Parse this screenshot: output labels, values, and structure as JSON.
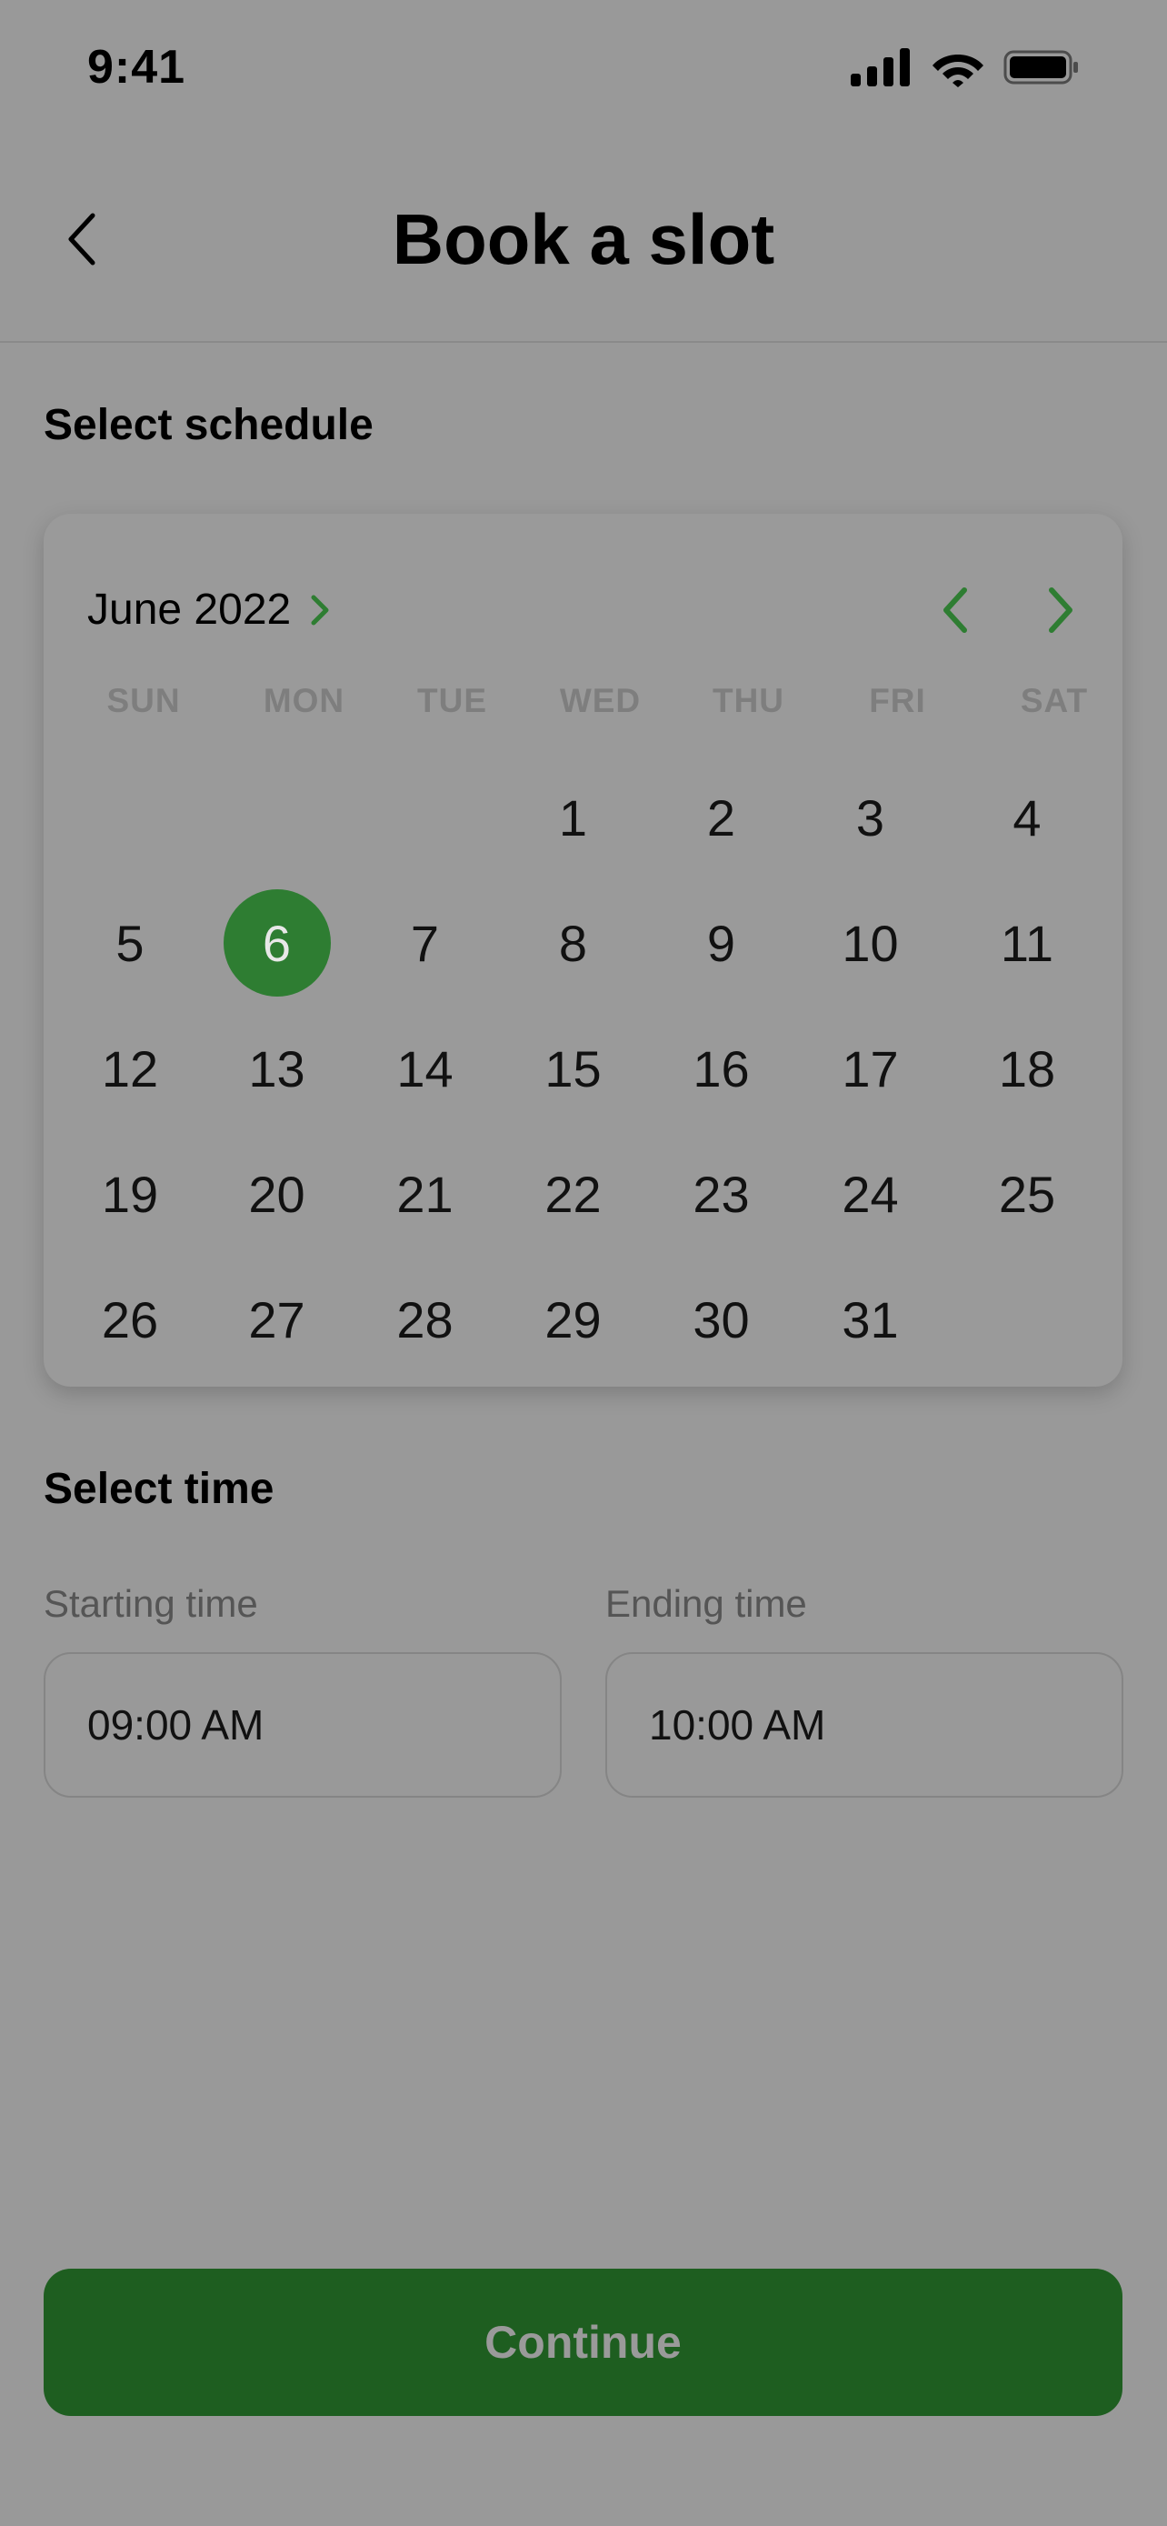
{
  "status_bar": {
    "time": "9:41"
  },
  "header": {
    "title": "Book a slot"
  },
  "schedule": {
    "label": "Select schedule",
    "month": "June 2022",
    "weekdays": [
      "SUN",
      "MON",
      "TUE",
      "WED",
      "THU",
      "FRI",
      "SAT"
    ],
    "days": [
      "",
      "",
      "",
      "1",
      "2",
      "3",
      "4",
      "5",
      "6",
      "7",
      "8",
      "9",
      "10",
      "11",
      "12",
      "13",
      "14",
      "15",
      "16",
      "17",
      "18",
      "19",
      "20",
      "21",
      "22",
      "23",
      "24",
      "25",
      "26",
      "27",
      "28",
      "29",
      "30",
      "31",
      ""
    ],
    "selected_day": "6",
    "accent_color": "#2e7d32"
  },
  "time": {
    "label": "Select time",
    "start_label": "Starting time",
    "start_value": "09:00 AM",
    "end_label": "Ending time",
    "end_value": "10:00 AM"
  },
  "footer": {
    "continue_label": "Continue"
  },
  "icons": {
    "signal": "signal-icon",
    "wifi": "wifi-icon",
    "battery": "battery-icon",
    "back": "chevron-left-icon",
    "month_expand": "chevron-right-icon",
    "prev_month": "chevron-left-icon",
    "next_month": "chevron-right-icon"
  }
}
